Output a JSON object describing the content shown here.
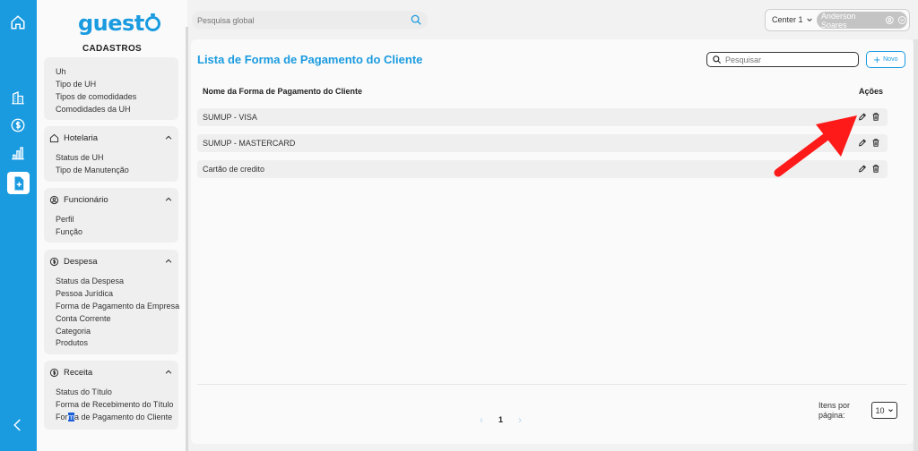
{
  "brand": {
    "logo": "guesto",
    "accent": "#1a9be0",
    "rail_color": "#1a9be0"
  },
  "rail": {
    "icons": [
      "home-icon",
      "buildings-icon",
      "dollar-icon",
      "bar-chart-icon",
      "document-add-icon",
      "chevron-left-icon"
    ]
  },
  "sidebar": {
    "title": "CADASTROS",
    "top_items": [
      "Uh",
      "Tipo de UH",
      "Tipos de comodidades",
      "Comodidades da UH"
    ],
    "groups": [
      {
        "label": "Hotelaria",
        "icon": "home-icon",
        "items": [
          "Status de UH",
          "Tipo de Manutenção"
        ]
      },
      {
        "label": "Funcionário",
        "icon": "user-circle-icon",
        "items": [
          "Perfil",
          "Função"
        ]
      },
      {
        "label": "Despesa",
        "icon": "dollar-icon",
        "items": [
          "Status da Despesa",
          "Pessoa Jurídica",
          "Forma de Pagamento da Empresa",
          "Conta Corrente",
          "Categoria",
          "Produtos"
        ]
      },
      {
        "label": "Receita",
        "icon": "dollar-icon",
        "items": [
          "Status do Título",
          "Forma de Recebimento do Título"
        ]
      }
    ],
    "last_item": {
      "before": "For",
      "selected": "m",
      "after": "a de Pagamento do Cliente"
    }
  },
  "topbar": {
    "search_placeholder": "Pesquisa global",
    "center": "Center 1",
    "user": "Anderson Soares"
  },
  "main": {
    "title": "Lista de Forma de Pagamento do Cliente",
    "search_placeholder": "Pesquisar",
    "new_label": "Novo",
    "col_name": "Nome da Forma de Pagamento do Cliente",
    "col_actions": "Ações",
    "rows": [
      "SUMUP - VISA",
      "SUMUP - MASTERCARD",
      "Cartão de credito"
    ],
    "pagination": {
      "prev": "‹",
      "page": "1",
      "next": "›"
    },
    "items_per_page_label": "Itens por página:",
    "items_per_page": "10"
  },
  "annotation": {
    "arrow_color": "#ff1a1a",
    "target": "edit-icon"
  }
}
